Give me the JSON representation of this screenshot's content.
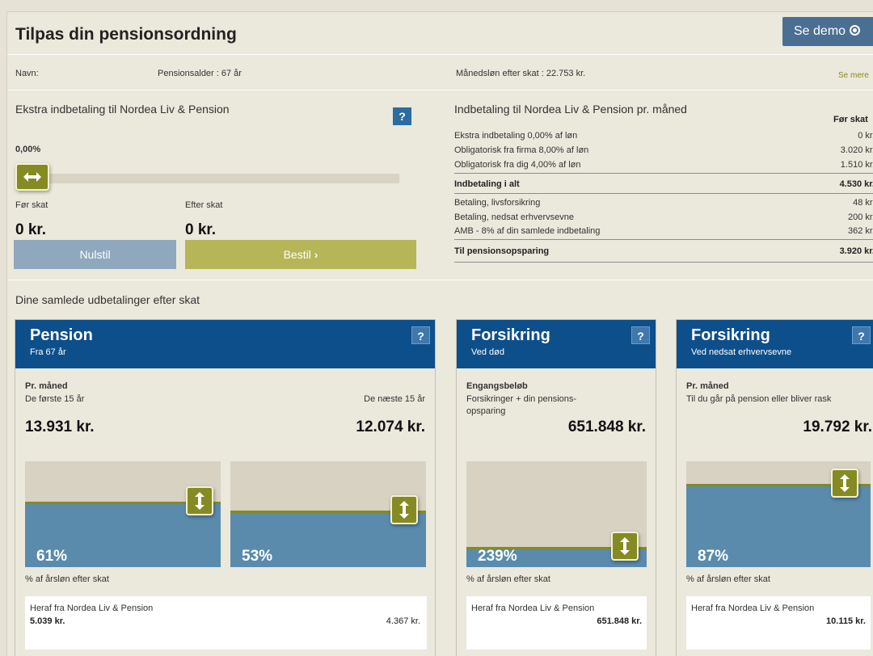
{
  "header": {
    "title": "Tilpas din pensionsordning",
    "demo_label": "Se demo"
  },
  "info": {
    "name_label": "Navn:",
    "pension_age": "Pensionsalder : 67 år",
    "salary": "Månedsløn efter skat : 22.753 kr.",
    "see_more": "Se mere"
  },
  "extra": {
    "title": "Ekstra indbetaling til Nordea Liv & Pension",
    "slider_value": "0,00%",
    "slider_fraction": 0,
    "before_tax_label": "Før skat",
    "before_tax_amount": "0 kr.",
    "after_tax_label": "Efter skat",
    "after_tax_amount": "0 kr.",
    "reset_label": "Nulstil",
    "order_label": "Bestil"
  },
  "payments": {
    "title": "Indbetaling til Nordea Liv & Pension pr. måned",
    "column_header": "Før skat",
    "rows": [
      {
        "label": "Ekstra indbetaling 0,00% af løn",
        "value": "0 kr."
      },
      {
        "label": "Obligatorisk fra firma 8,00% af løn",
        "value": "3.020 kr."
      },
      {
        "label": "Obligatorisk fra dig 4,00% af løn",
        "value": "1.510 kr."
      },
      {
        "label": "Indbetaling i alt",
        "value": "4.530 kr."
      },
      {
        "label": "Betaling, livsforsikring",
        "value": "48 kr."
      },
      {
        "label": "Betaling, nedsat erhvervsevne",
        "value": "200 kr."
      },
      {
        "label": "AMB - 8% af din samlede indbetaling",
        "value": "362 kr."
      },
      {
        "label": "Til pensionsopsparing",
        "value": "3.920 kr."
      }
    ]
  },
  "payouts": {
    "title": "Dine samlede udbetalinger efter skat",
    "pension": {
      "title": "Pension",
      "subtitle": "Fra 67 år",
      "period_label": "Pr. måned",
      "first_label": "De første 15 år",
      "next_label": "De næste 15 år",
      "first_amount": "13.931 kr.",
      "next_amount": "12.074 kr.",
      "first_pct": "61%",
      "first_level": 0.61,
      "next_pct": "53%",
      "next_level": 0.53,
      "note": "% af årsløn efter skat",
      "from_label": "Heraf fra Nordea Liv & Pension",
      "from_first": "5.039 kr.",
      "from_next": "4.367 kr."
    },
    "death": {
      "title": "Forsikring",
      "subtitle": "Ved død",
      "period_label": "Engangsbeløb",
      "desc": "Forsikringer + din pensions-opsparing",
      "amount": "651.848 kr.",
      "pct": "239%",
      "level": 0.18,
      "note": "% af årsløn efter skat",
      "from_label": "Heraf fra Nordea Liv & Pension",
      "from_value": "651.848 kr."
    },
    "disability": {
      "title": "Forsikring",
      "subtitle": "Ved nedsat erhvervsevne",
      "period_label": "Pr. måned",
      "desc": "Til du går på pension eller bliver rask",
      "amount": "19.792 kr.",
      "pct": "87%",
      "level": 0.78,
      "note": "% af årsløn efter skat",
      "from_label": "Heraf fra Nordea Liv & Pension",
      "from_value": "10.115 kr."
    }
  },
  "help_symbol": "?"
}
